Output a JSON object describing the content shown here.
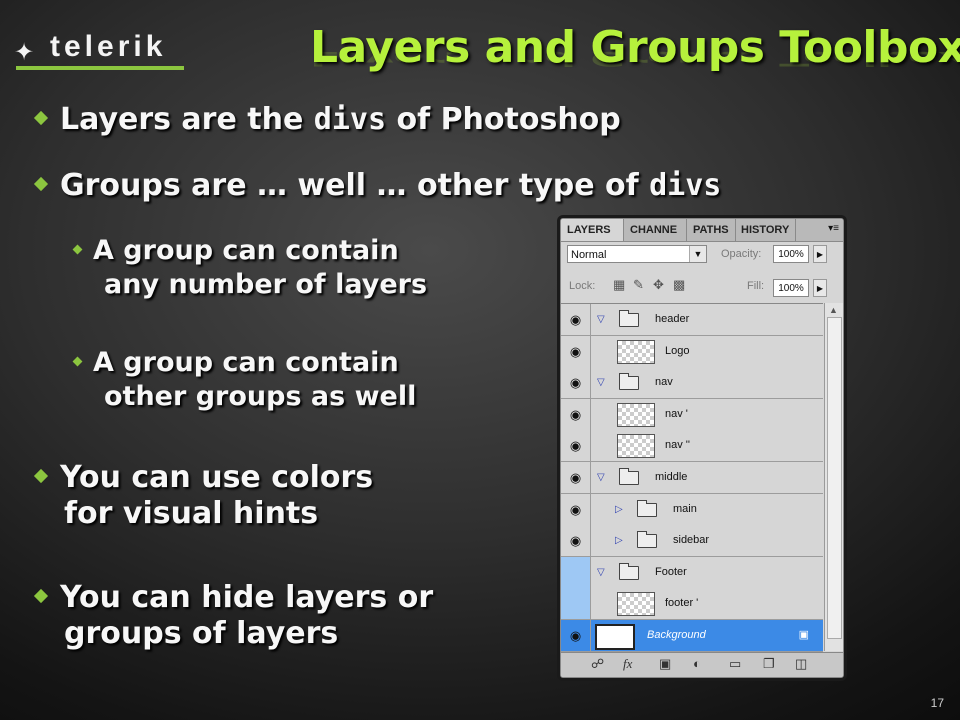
{
  "brand": {
    "name": "telerik"
  },
  "slide": {
    "title": "Layers and Groups Toolbox",
    "page_number": "17",
    "bullets": [
      {
        "pre": "Layers are the ",
        "code": "divs",
        "post": " of Photoshop"
      },
      {
        "pre": "Groups are … well … other type of ",
        "code": "divs",
        "post": ""
      }
    ],
    "sub_bullets": [
      {
        "line1": "A group can contain",
        "line2": "any number of layers"
      },
      {
        "line1": "A group can contain",
        "line2": "other groups as well"
      }
    ],
    "bullets2": [
      {
        "line1": "You can use colors",
        "line2": "for visual hints"
      },
      {
        "line1": "You can hide layers or",
        "line2": "groups of layers"
      }
    ]
  },
  "panel": {
    "tabs": [
      "LAYERS",
      "CHANNE",
      "PATHS",
      "HISTORY"
    ],
    "blend_mode": "Normal",
    "opacity_label": "Opacity:",
    "opacity_value": "100%",
    "lock_label": "Lock:",
    "fill_label": "Fill:",
    "fill_value": "100%",
    "layers": [
      {
        "name": "header",
        "kind": "group",
        "expanded": true,
        "depth": 0,
        "visible": true
      },
      {
        "name": "Logo",
        "kind": "layer",
        "depth": 1,
        "visible": true
      },
      {
        "name": "nav",
        "kind": "group",
        "expanded": true,
        "depth": 0,
        "visible": true
      },
      {
        "name": "nav '",
        "kind": "layer",
        "depth": 1,
        "visible": true
      },
      {
        "name": "nav ''",
        "kind": "layer",
        "depth": 1,
        "visible": true
      },
      {
        "name": "middle",
        "kind": "group",
        "expanded": true,
        "depth": 0,
        "visible": true
      },
      {
        "name": "main",
        "kind": "group",
        "expanded": false,
        "depth": 1,
        "visible": true
      },
      {
        "name": "sidebar",
        "kind": "group",
        "expanded": false,
        "depth": 1,
        "visible": true
      },
      {
        "name": "Footer",
        "kind": "group",
        "expanded": true,
        "depth": 0,
        "visible": false
      },
      {
        "name": "footer '",
        "kind": "layer",
        "depth": 1,
        "visible": false
      },
      {
        "name": "Background",
        "kind": "background",
        "depth": 0,
        "visible": true,
        "selected": true,
        "locked": true
      }
    ],
    "footer_icons": [
      "link-icon",
      "fx-icon",
      "mask-icon",
      "adjustment-icon",
      "new-group-icon",
      "new-layer-icon",
      "trash-icon"
    ]
  },
  "colors": {
    "title": "#b6f13c",
    "accent": "#8cc63f",
    "selection": "#3c8ae6"
  }
}
